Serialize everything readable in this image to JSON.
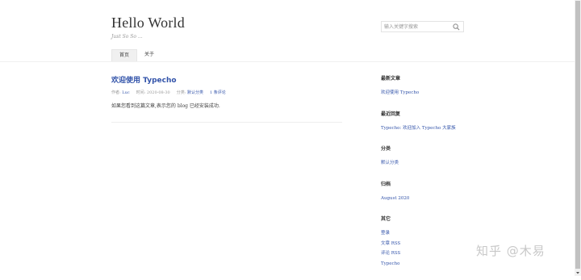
{
  "site": {
    "title": "Hello World",
    "description": "Just So So ..."
  },
  "search": {
    "placeholder": "输入关键字搜索"
  },
  "nav": {
    "items": [
      {
        "label": "首页"
      },
      {
        "label": "关于"
      }
    ]
  },
  "post": {
    "title": "欢迎使用 Typecho",
    "author_label": "作者:",
    "author": "Luc",
    "time_label": "时间:",
    "time": "2020-08-30",
    "category_label": "分类:",
    "category": "默认分类",
    "comments": "1 条评论",
    "content": "如果您看到这篇文章,表示您的 blog 已经安装成功."
  },
  "sidebar": {
    "recent_posts": {
      "title": "最新文章",
      "items": [
        "欢迎使用 Typecho"
      ]
    },
    "recent_comments": {
      "title": "最近回复",
      "items": [
        "Typecho: 欢迎加入 Typecho 大家族"
      ]
    },
    "categories": {
      "title": "分类",
      "items": [
        "默认分类"
      ]
    },
    "archives": {
      "title": "归档",
      "items": [
        "August 2020"
      ]
    },
    "other": {
      "title": "其它",
      "items": [
        "登录",
        "文章 RSS",
        "评论 RSS",
        "Typecho"
      ]
    }
  },
  "watermark": "知乎 @木易",
  "colors": {
    "link": "#3354aa",
    "text": "#444444",
    "muted": "#999999"
  }
}
